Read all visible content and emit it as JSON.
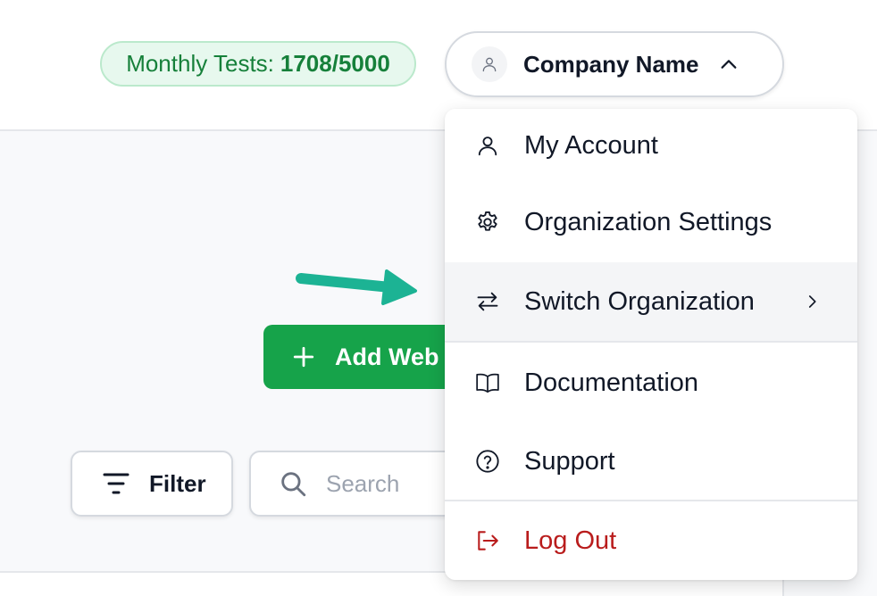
{
  "header": {
    "usage": {
      "label": "Monthly Tests:",
      "value": "1708/5000"
    },
    "account": {
      "name": "Company Name"
    }
  },
  "main": {
    "add_button_label": "Add Web",
    "filter_label": "Filter",
    "search": {
      "placeholder": "Search",
      "value": ""
    }
  },
  "account_menu": {
    "items": [
      {
        "label": "My Account",
        "icon": "user-icon"
      },
      {
        "label": "Organization Settings",
        "icon": "gear-icon"
      },
      {
        "label": "Switch Organization",
        "icon": "swap-arrows-icon",
        "has_submenu": true,
        "highlighted": true
      },
      {
        "label": "Documentation",
        "icon": "book-icon"
      },
      {
        "label": "Support",
        "icon": "help-circle-icon"
      },
      {
        "label": "Log Out",
        "icon": "logout-icon",
        "danger": true
      }
    ]
  },
  "colors": {
    "accent_green": "#16a34a",
    "badge_bg": "#e7f8ee",
    "badge_text": "#16803a",
    "danger": "#b91c1c",
    "annotation_arrow": "#1cb394"
  }
}
